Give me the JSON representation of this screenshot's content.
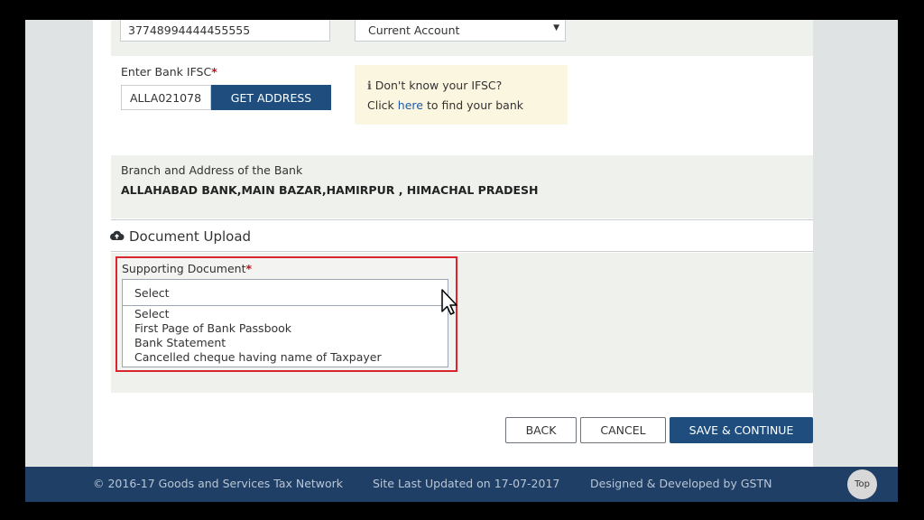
{
  "account": {
    "number_value": "37748994444455555",
    "type_value": "Current Account"
  },
  "ifsc": {
    "label": "Enter Bank IFSC",
    "required_mark": "*",
    "value": "ALLA021078",
    "get_address_label": "GET ADDRESS",
    "help_line1": "Don't know your IFSC?",
    "help_prefix": "Click",
    "help_link": "here",
    "help_suffix": "to find your bank"
  },
  "branch": {
    "label": "Branch and Address of the Bank",
    "value": "ALLAHABAD BANK,MAIN BAZAR,HAMIRPUR , HIMACHAL PRADESH"
  },
  "document_upload": {
    "title": "Document Upload",
    "supporting_label": "Supporting Document",
    "required_mark": "*",
    "selected": "Select",
    "options": [
      "Select",
      "First Page of Bank Passbook",
      "Bank Statement",
      "Cancelled cheque having name of Taxpayer"
    ]
  },
  "actions": {
    "back": "BACK",
    "cancel": "CANCEL",
    "save_continue": "SAVE & CONTINUE"
  },
  "footer": {
    "copyright": "© 2016-17 Goods and Services Tax Network",
    "updated": "Site Last Updated on 17-07-2017",
    "designed": "Designed & Developed by GSTN",
    "top": "Top"
  },
  "colors": {
    "primary": "#1f4e7e",
    "footer": "#1f3f66",
    "required": "#c0141c",
    "highlight": "#d9252b"
  }
}
